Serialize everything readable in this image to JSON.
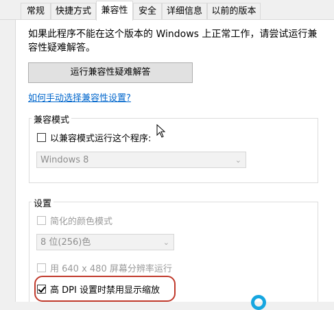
{
  "tabs": [
    {
      "label": "常规",
      "active": false
    },
    {
      "label": "快捷方式",
      "active": false
    },
    {
      "label": "兼容性",
      "active": true
    },
    {
      "label": "安全",
      "active": false
    },
    {
      "label": "详细信息",
      "active": false
    },
    {
      "label": "以前的版本",
      "active": false
    }
  ],
  "intro_text": "如果此程序不能在这个版本的 Windows 上正常工作，请尝试运行兼容性疑难解答。",
  "troubleshoot_button": "运行兼容性疑难解答",
  "manual_link": "如何手动选择兼容性设置?",
  "compat_mode": {
    "group_label": "兼容模式",
    "checkbox_label": "以兼容模式运行这个程序:",
    "checked": false,
    "select_value": "Windows 8"
  },
  "settings": {
    "group_label": "设置",
    "reduced_color": {
      "label": "简化的颜色模式",
      "checked": false,
      "disabled": true
    },
    "color_select_value": "8 位(256)色",
    "resolution_640": {
      "label": "用 640 x 480 屏幕分辨率运行",
      "checked": false,
      "disabled": true
    },
    "high_dpi": {
      "label": "高 DPI 设置时禁用显示缩放",
      "checked": true,
      "disabled": false
    }
  },
  "colors": {
    "link": "#0066cc",
    "highlight_annotation": "#c0392b",
    "watermark": "#16a6e0"
  }
}
